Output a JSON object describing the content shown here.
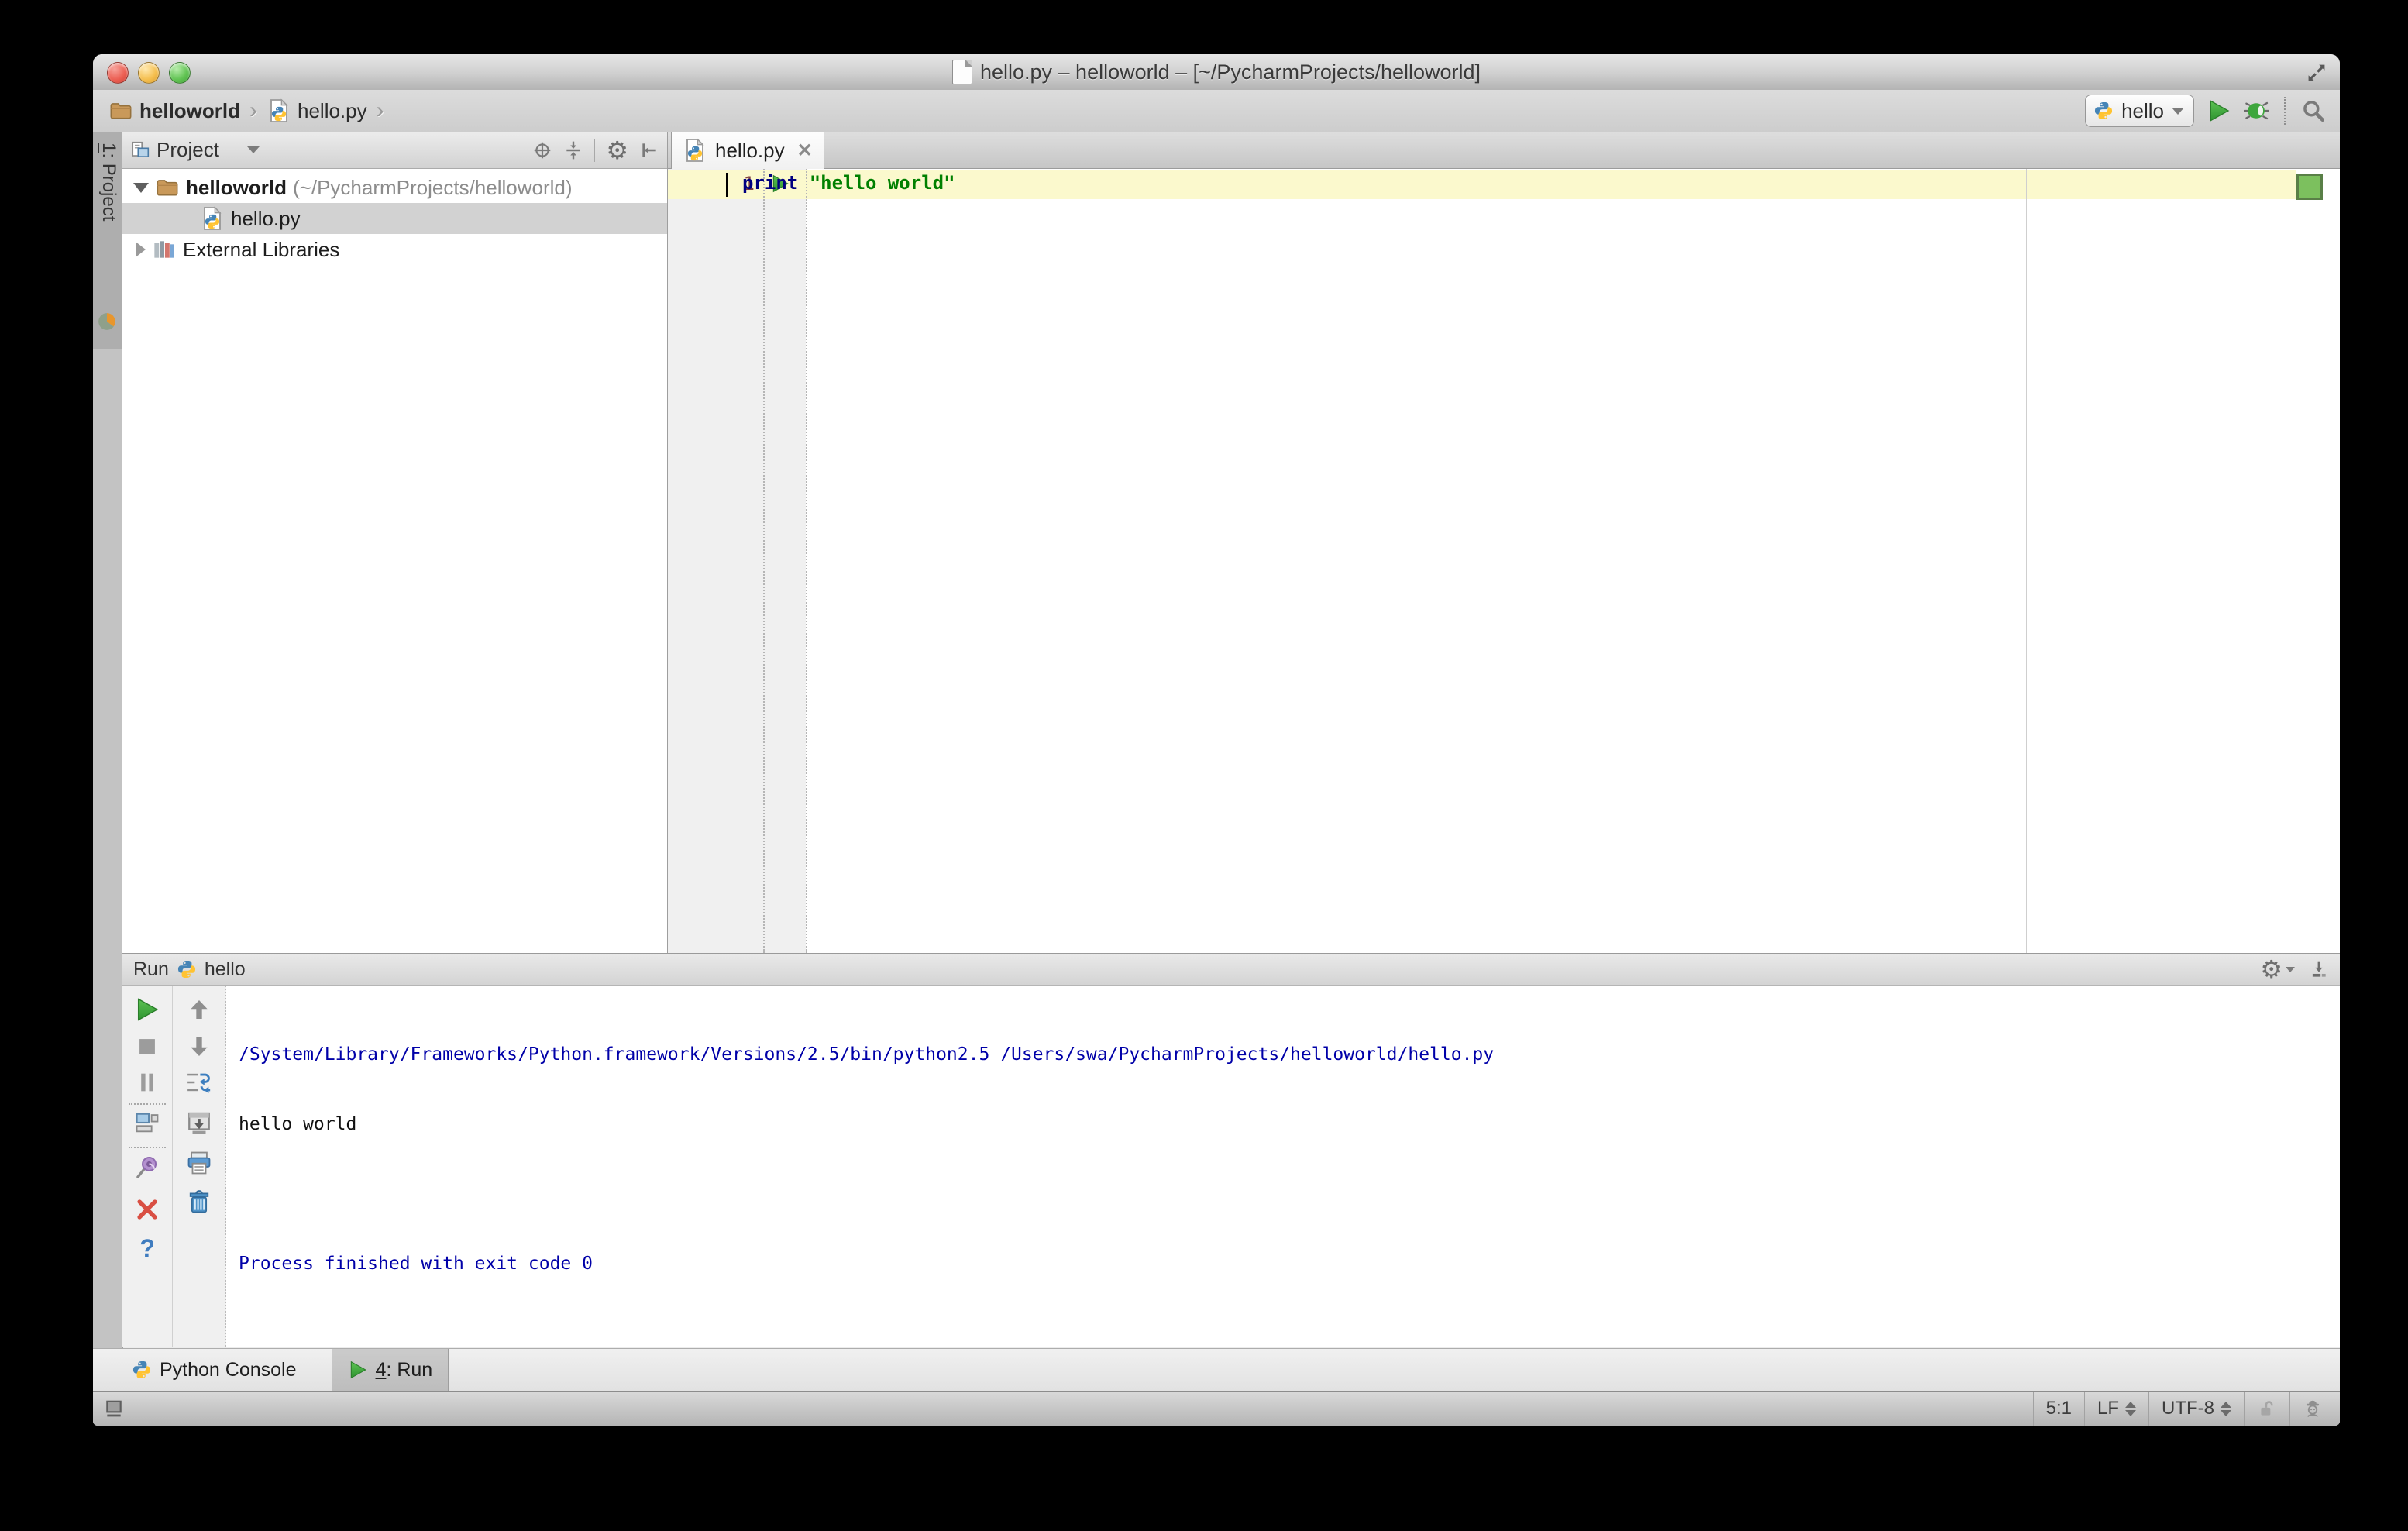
{
  "titlebar": {
    "title": "hello.py – helloworld – [~/PycharmProjects/helloworld]"
  },
  "toolbar": {
    "breadcrumb_project": "helloworld",
    "breadcrumb_file": "hello.py",
    "run_config": "hello"
  },
  "stripe": {
    "project_number": "1",
    "project_label": ": Project"
  },
  "project_panel": {
    "header_label": "Project",
    "tree": {
      "root_name": "helloworld",
      "root_path": "(~/PycharmProjects/helloworld)",
      "file_name": "hello.py",
      "external_libraries": "External Libraries"
    }
  },
  "editor": {
    "tab_label": "hello.py",
    "close_glyph": "✕",
    "line_number": "1",
    "code": {
      "keyword": "print ",
      "string": "\"hello world\""
    }
  },
  "run_panel": {
    "title": "Run",
    "config_name": "hello",
    "help_glyph": "?",
    "console_lines": [
      "/System/Library/Frameworks/Python.framework/Versions/2.5/bin/python2.5 /Users/swa/PycharmProjects/helloworld/hello.py",
      "hello world",
      "",
      "Process finished with exit code 0"
    ]
  },
  "bottom_bar": {
    "python_console_label": "Python Console",
    "run_tab_number": "4",
    "run_tab_label": ": Run"
  },
  "status_bar": {
    "caret_position": "5:1",
    "line_separator": "LF",
    "encoding": "UTF-8"
  },
  "colors": {
    "run_green": "#3fa33f",
    "caret_row_yellow": "#fbf9cd",
    "keyword_blue": "#000080",
    "string_green": "#008000",
    "console_system_blue": "#0000a8",
    "selection_gray": "#d2d2d2"
  }
}
